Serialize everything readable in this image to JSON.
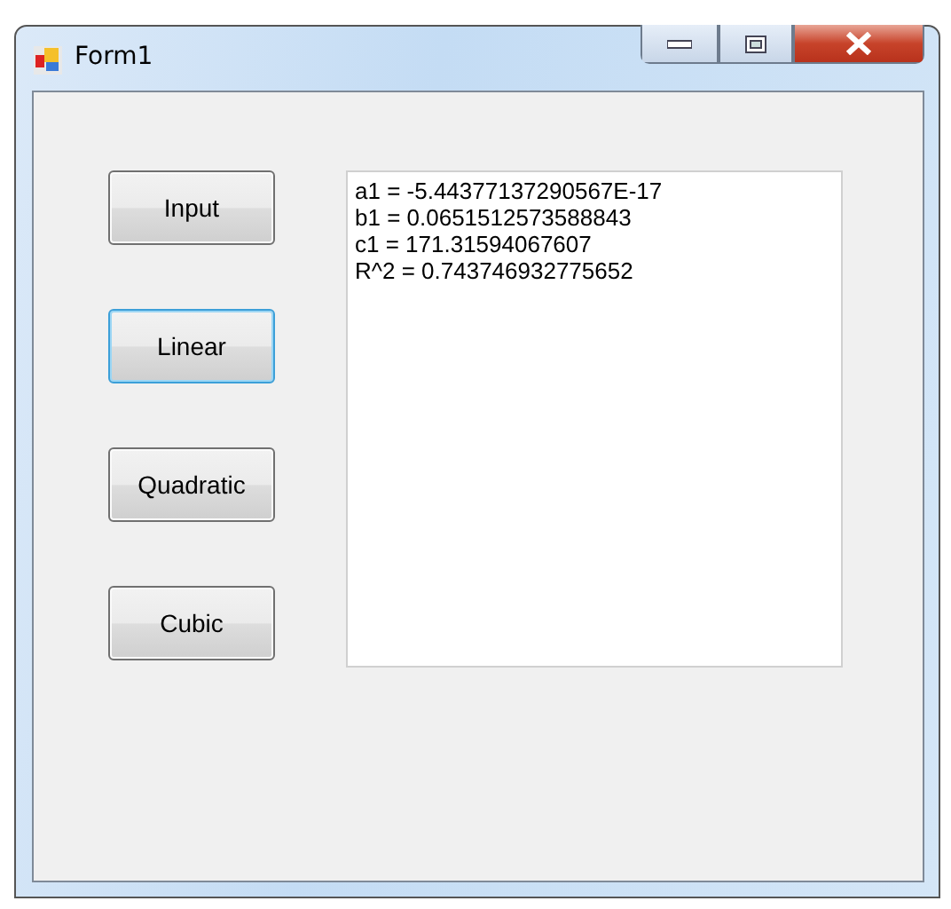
{
  "window": {
    "title": "Form1"
  },
  "buttons": [
    {
      "label": "Input",
      "focused": false
    },
    {
      "label": "Linear",
      "focused": true
    },
    {
      "label": "Quadratic",
      "focused": false
    },
    {
      "label": "Cubic",
      "focused": false
    }
  ],
  "output": {
    "lines": [
      "a1 = -5.44377137290567E-17",
      "b1 = 0.0651512573588843",
      "c1 = 171.31594067607",
      "R^2 = 0.743746932775652"
    ]
  }
}
